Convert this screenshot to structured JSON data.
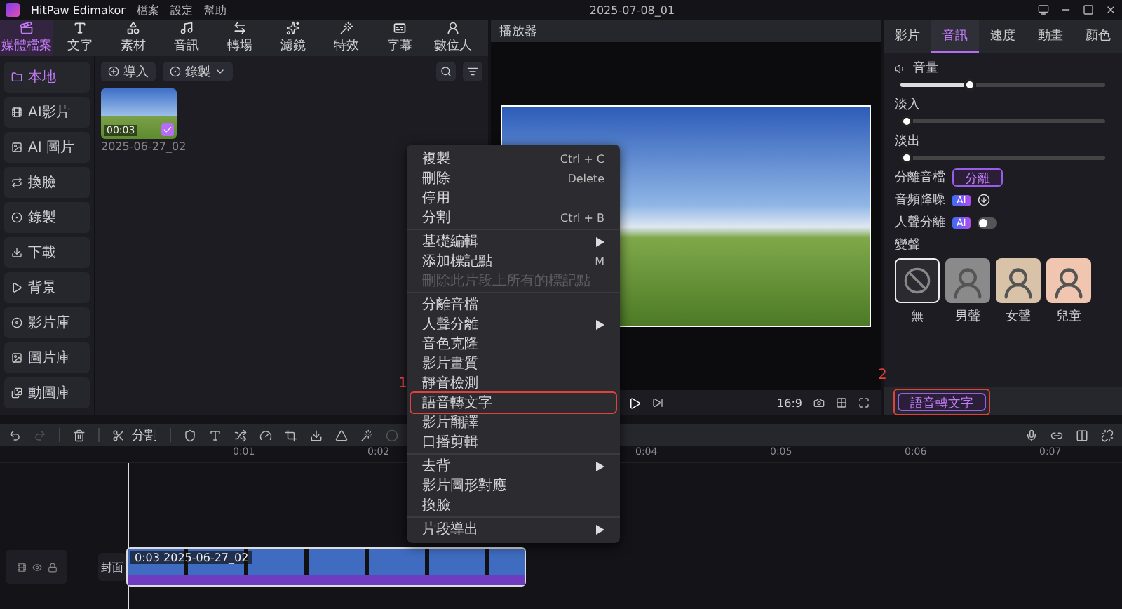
{
  "app": {
    "name": "HitPaw Edimakor",
    "menus": [
      "檔案",
      "設定",
      "幫助"
    ],
    "project": "2025-07-08_01"
  },
  "toolbar": {
    "tabs": [
      {
        "label": "媒體檔案",
        "selected": true
      },
      {
        "label": "文字",
        "selected": false
      },
      {
        "label": "素材",
        "selected": false
      },
      {
        "label": "音訊",
        "selected": false
      },
      {
        "label": "轉場",
        "selected": false
      },
      {
        "label": "濾鏡",
        "selected": false
      },
      {
        "label": "特效",
        "selected": false
      },
      {
        "label": "字幕",
        "selected": false
      },
      {
        "label": "數位人",
        "selected": false
      }
    ]
  },
  "sidebar": {
    "items": [
      {
        "label": "本地",
        "selected": true
      },
      {
        "label": "AI影片",
        "selected": false
      },
      {
        "label": "AI 圖片",
        "selected": false
      },
      {
        "label": "換臉",
        "selected": false
      },
      {
        "label": "錄製",
        "selected": false
      },
      {
        "label": "下載",
        "selected": false
      },
      {
        "label": "背景",
        "selected": false
      },
      {
        "label": "影片庫",
        "selected": false
      },
      {
        "label": "圖片庫",
        "selected": false
      },
      {
        "label": "動圖庫",
        "selected": false
      }
    ]
  },
  "media": {
    "import": "導入",
    "record": "錄製",
    "clips": [
      {
        "duration": "00:03",
        "name": "2025-06-27_02",
        "checked": true
      }
    ]
  },
  "player": {
    "title": "播放器",
    "aspect": "16:9"
  },
  "inspector": {
    "tabs": [
      {
        "label": "影片",
        "selected": false
      },
      {
        "label": "音訊",
        "selected": true
      },
      {
        "label": "速度",
        "selected": false
      },
      {
        "label": "動畫",
        "selected": false
      },
      {
        "label": "顏色",
        "selected": false
      }
    ],
    "sliders": [
      {
        "label": "音量",
        "level": 0.33
      },
      {
        "label": "淡入",
        "level": 0
      },
      {
        "label": "淡出",
        "level": 0
      }
    ],
    "separate": {
      "label": "分離音檔",
      "button": "分離"
    },
    "denoise": {
      "label": "音頻降噪",
      "badge": "AI"
    },
    "vocal": {
      "label": "人聲分離",
      "badge": "AI",
      "on": false
    },
    "voice_change": {
      "label": "變聲",
      "options": [
        {
          "label": "無",
          "selected": true
        },
        {
          "label": "男聲",
          "selected": false
        },
        {
          "label": "女聲",
          "selected": false
        },
        {
          "label": "兒童",
          "selected": false
        }
      ]
    },
    "speech_button": "語音轉文字"
  },
  "timeline": {
    "split": "分割",
    "ticks": [
      "0:01",
      "0:02",
      "0:04",
      "0:05",
      "0:06",
      "0:07"
    ],
    "cover": "封面",
    "clip": {
      "duration": "0:03",
      "name": "2025-06-27_02"
    }
  },
  "context_menu": {
    "groups": [
      [
        {
          "label": "複製",
          "shortcut": "Ctrl + C",
          "submenu": false,
          "disabled": false,
          "highlighted": false
        },
        {
          "label": "刪除",
          "shortcut": "Delete",
          "submenu": false,
          "disabled": false,
          "highlighted": false
        },
        {
          "label": "停用",
          "submenu": false,
          "disabled": false,
          "highlighted": false
        },
        {
          "label": "分割",
          "shortcut": "Ctrl + B",
          "submenu": false,
          "disabled": false,
          "highlighted": false
        }
      ],
      [
        {
          "label": "基礎編輯",
          "submenu": true,
          "disabled": false,
          "highlighted": false
        },
        {
          "label": "添加標記點",
          "shortcut": "M",
          "submenu": false,
          "disabled": false,
          "highlighted": false
        },
        {
          "label": "刪除此片段上所有的標記點",
          "submenu": false,
          "disabled": true,
          "highlighted": false
        }
      ],
      [
        {
          "label": "分離音檔",
          "submenu": false,
          "disabled": false,
          "highlighted": false
        },
        {
          "label": "人聲分離",
          "submenu": true,
          "disabled": false,
          "highlighted": false
        },
        {
          "label": "音色克隆",
          "submenu": false,
          "disabled": false,
          "highlighted": false
        },
        {
          "label": "影片畫質",
          "submenu": false,
          "disabled": false,
          "highlighted": false
        },
        {
          "label": "靜音檢測",
          "submenu": false,
          "disabled": false,
          "highlighted": false
        },
        {
          "label": "語音轉文字",
          "submenu": false,
          "disabled": false,
          "highlighted": true
        },
        {
          "label": "影片翻譯",
          "submenu": false,
          "disabled": false,
          "highlighted": false
        },
        {
          "label": "口播剪輯",
          "submenu": false,
          "disabled": false,
          "highlighted": false
        }
      ],
      [
        {
          "label": "去背",
          "submenu": true,
          "disabled": false,
          "highlighted": false
        },
        {
          "label": "影片圖形對應",
          "submenu": false,
          "disabled": false,
          "highlighted": false
        },
        {
          "label": "換臉",
          "submenu": false,
          "disabled": false,
          "highlighted": false
        }
      ],
      [
        {
          "label": "片段導出",
          "submenu": true,
          "disabled": false,
          "highlighted": false
        }
      ]
    ]
  },
  "annotations": [
    {
      "label": "1"
    },
    {
      "label": "2"
    }
  ]
}
